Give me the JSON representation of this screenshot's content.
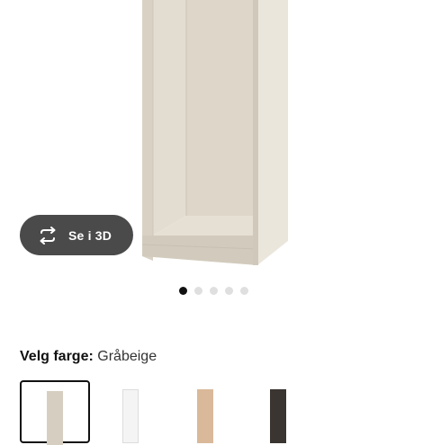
{
  "product_image": {
    "icon": "wardrobe-frame-image"
  },
  "view_3d": {
    "label": "Se i 3D",
    "icon": "rotate-3d-icon"
  },
  "carousel": {
    "count": 5,
    "active_index": 0
  },
  "color": {
    "label": "Velg farge:",
    "value": "Gråbeige",
    "options": [
      {
        "color": "#d6cfc1",
        "selected": true
      },
      {
        "color": "#f4f4f4",
        "selected": false
      },
      {
        "color": "#d9b99a",
        "selected": false
      },
      {
        "color": "#3b3531",
        "selected": false
      }
    ]
  }
}
